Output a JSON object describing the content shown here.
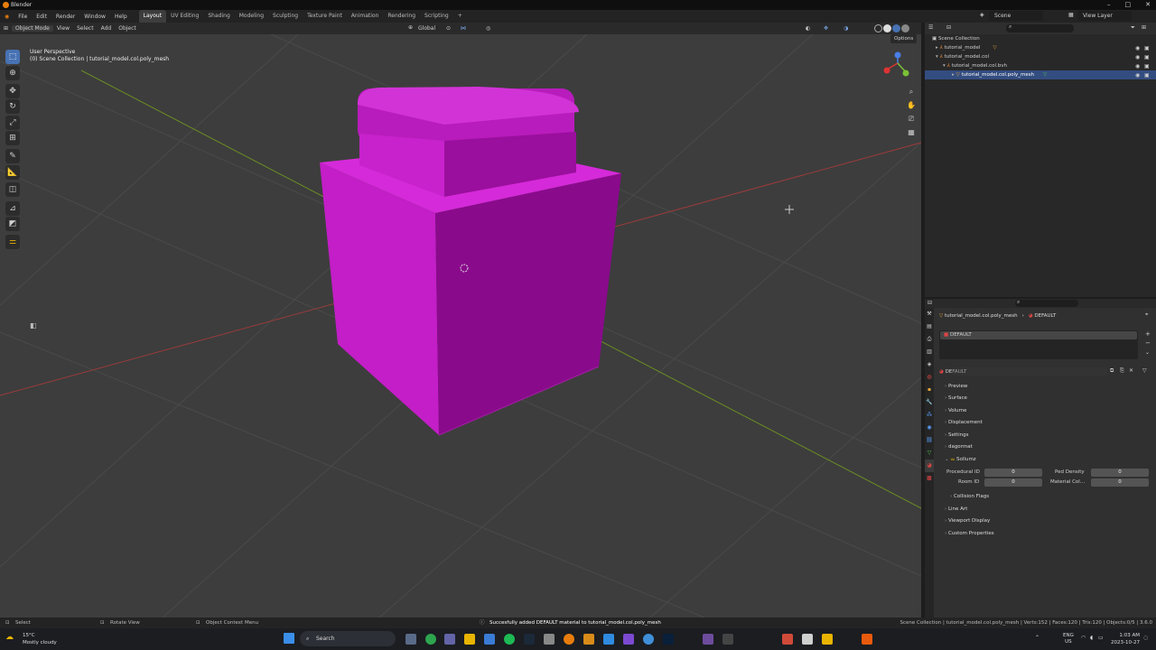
{
  "titlebar": {
    "title": "Blender",
    "minimize_icon": "–",
    "maximize_icon": "□",
    "close_icon": "✕"
  },
  "menu": {
    "items": [
      "File",
      "Edit",
      "Render",
      "Window",
      "Help"
    ]
  },
  "workspaces": {
    "tabs": [
      "Layout",
      "UV Editing",
      "Shading",
      "Modeling",
      "Sculpting",
      "Texture Paint",
      "Animation",
      "Rendering",
      "Scripting"
    ],
    "active": "Layout",
    "add": "+"
  },
  "scene": {
    "label": "Scene",
    "view_layer": "View Layer"
  },
  "viewport_header": {
    "mode": "Object Mode",
    "menus": [
      "View",
      "Select",
      "Add",
      "Object"
    ],
    "transform_orientation": "Global",
    "options": "Options"
  },
  "viewport": {
    "perspective": "User Perspective",
    "collection_path": "(0) Scene Collection | tutorial_model.col.poly_mesh"
  },
  "gizmo": {
    "x": "X",
    "y": "Y",
    "z": "Z"
  },
  "outliner": {
    "root": "Scene Collection",
    "items": [
      "tutorial_model",
      "tutorial_model.col",
      "tutorial_model.col.bvh",
      "tutorial_model.col.poly_mesh"
    ]
  },
  "properties": {
    "breadcrumb_object": "tutorial_model.col.poly_mesh",
    "breadcrumb_material": "DEFAULT",
    "slot_name": "DEFAULT",
    "material_name": "DEFAULT",
    "panels": [
      "Preview",
      "Surface",
      "Volume",
      "Displacement",
      "Settings",
      "dagormat",
      "Sollumz"
    ],
    "sollumz_fields": {
      "procedural_id_label": "Procedural ID",
      "procedural_id": "0",
      "ped_density_label": "Ped Density",
      "ped_density": "0",
      "room_id_label": "Room ID",
      "room_id": "0",
      "material_col_label": "Material Col...",
      "material_col": "0"
    },
    "collision_flags": "Collision Flags",
    "panels_after": [
      "Line Art",
      "Viewport Display",
      "Custom Properties"
    ]
  },
  "statusbar": {
    "select": "Select",
    "rotate": "Rotate View",
    "context_menu": "Object Context Menu",
    "message": "Succesfully added DEFAULT material to tutorial_model.col.poly_mesh",
    "stats": "Scene Collection | tutorial_model.col.poly_mesh | Verts:152 | Faces:120 | Tris:120 | Objects:0/5 | 3.6.0"
  },
  "taskbar": {
    "weather_temp": "15°C",
    "weather_desc": "Mostly cloudy",
    "search": "Search",
    "lang1": "ENG",
    "lang2": "US",
    "time": "1:03 AM",
    "date": "2023-10-27"
  },
  "colors": {
    "accent": "#4772b3",
    "object": "#c31ec7",
    "object_dark": "#8a0a8c"
  }
}
